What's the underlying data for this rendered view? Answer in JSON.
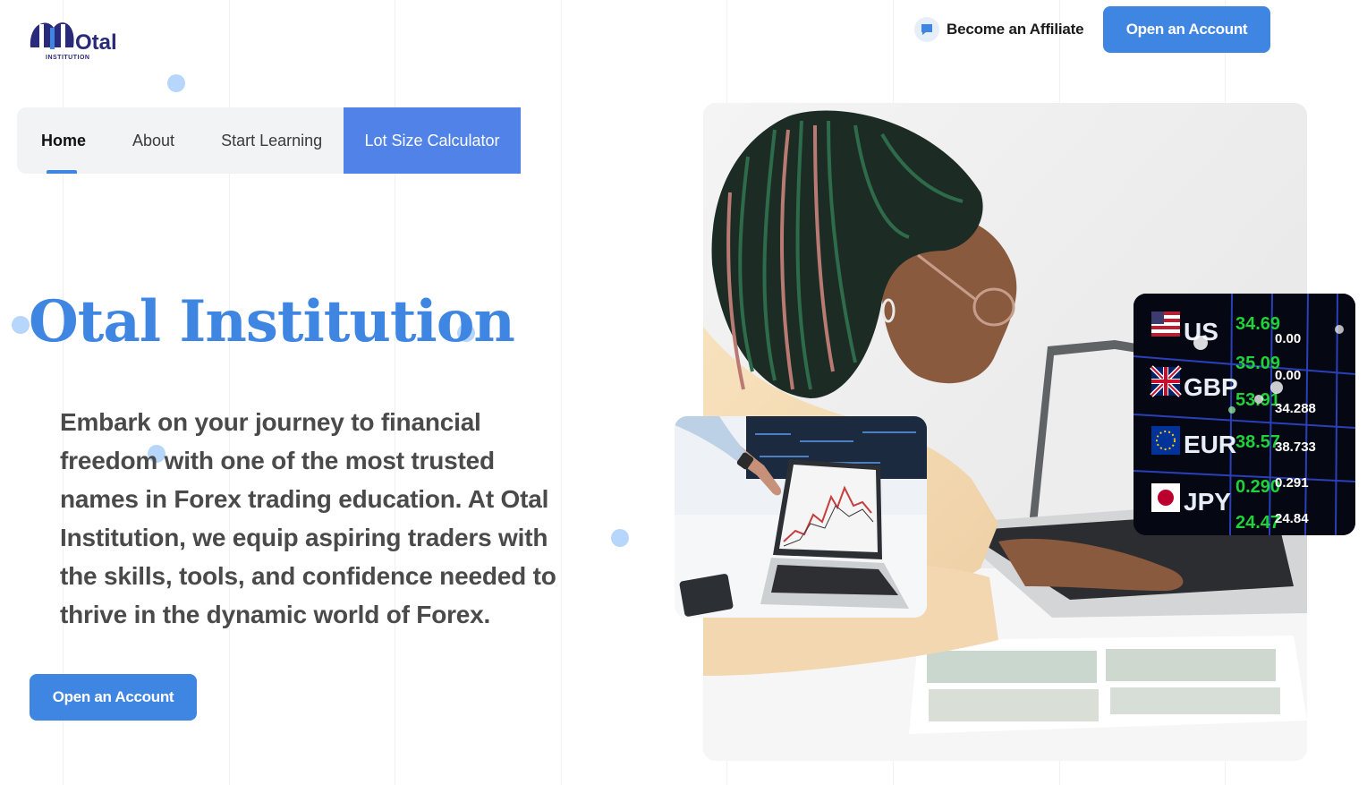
{
  "logo": {
    "name": "Otal",
    "tagline": "INSTITUTION"
  },
  "header": {
    "affiliate_label": "Become an Affiliate",
    "open_account_label": "Open an Account"
  },
  "nav": {
    "items": [
      {
        "label": "Home",
        "active": true
      },
      {
        "label": "About"
      },
      {
        "label": "Start Learning"
      },
      {
        "label": "Lot Size Calculator",
        "highlighted": true
      }
    ]
  },
  "hero": {
    "title": "Otal Institution",
    "description": "Embark on your journey to financial freedom with one of the most trusted names in Forex trading education. At Otal Institution, we equip aspiring traders with the skills, tools, and confidence needed to thrive in the dynamic world of Forex.",
    "cta_label": "Open an Account"
  },
  "currency_board": {
    "rows": [
      {
        "currency": "US",
        "values": [
          "34.69",
          "0.00"
        ]
      },
      {
        "currency": "GBP",
        "values": [
          "35.09",
          "0.00"
        ]
      },
      {
        "currency": "GBP",
        "values": [
          "53.91",
          "34.288"
        ]
      },
      {
        "currency": "EUR",
        "values": [
          "38.57",
          "38.733"
        ]
      },
      {
        "currency": "JPY",
        "values": [
          "0.290",
          "0.291"
        ]
      },
      {
        "currency": "",
        "values": [
          "24.47",
          "24.84"
        ]
      }
    ]
  },
  "colors": {
    "accent": "#3f86e3",
    "nav_highlight": "#5182e8",
    "title": "#3f86e3"
  }
}
